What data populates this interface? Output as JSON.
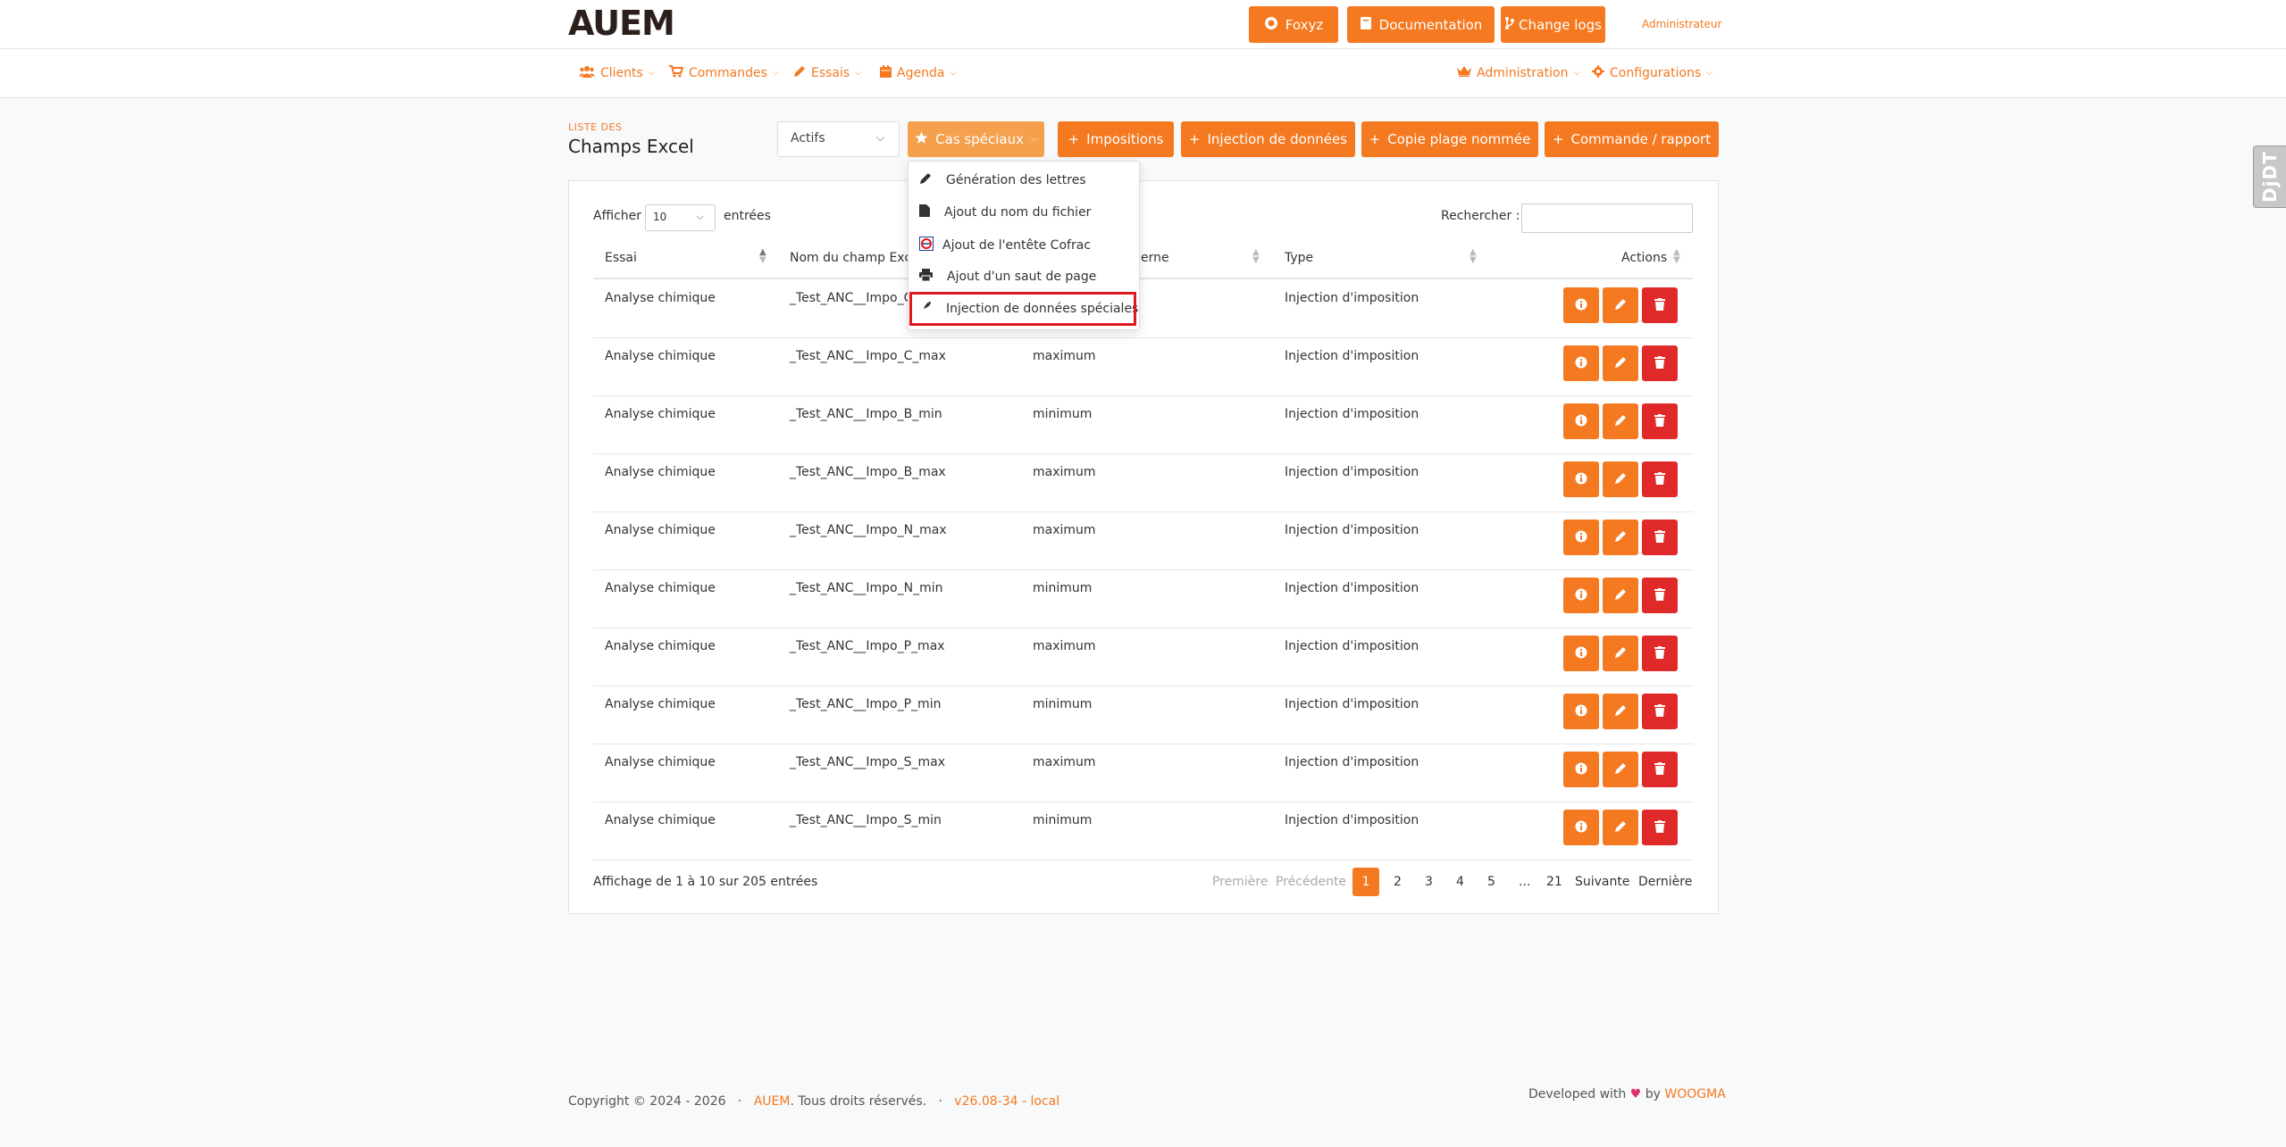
{
  "brand": {
    "logo_text": "AUEM"
  },
  "topbar": {
    "buttons": [
      {
        "label": "Foxyz",
        "icon": "foxyz-icon"
      },
      {
        "label": "Documentation",
        "icon": "book-icon"
      },
      {
        "label": "Change logs",
        "icon": "branch-icon"
      }
    ],
    "user_label": "Administrateur"
  },
  "nav": {
    "left": [
      {
        "label": "Clients",
        "icon": "users-icon"
      },
      {
        "label": "Commandes",
        "icon": "cart-icon"
      },
      {
        "label": "Essais",
        "icon": "pencil-icon"
      },
      {
        "label": "Agenda",
        "icon": "calendar-icon"
      }
    ],
    "right": [
      {
        "label": "Administration",
        "icon": "crown-icon"
      },
      {
        "label": "Configurations",
        "icon": "gear-icon"
      }
    ]
  },
  "page": {
    "subtitle": "LISTE DES",
    "title": "Champs Excel",
    "status_value": "Actifs"
  },
  "actions": {
    "special": "Cas spéciaux",
    "impositions": "Impositions",
    "injection": "Injection de données",
    "copy_range": "Copie plage nommée",
    "command_report": "Commande / rapport"
  },
  "dropdown": {
    "items": [
      {
        "label": "Génération des lettres",
        "icon": "pen-icon"
      },
      {
        "label": "Ajout du nom du fichier",
        "icon": "file-icon"
      },
      {
        "label": "Ajout de l'entête Cofrac",
        "icon": "cofrac-icon"
      },
      {
        "label": "Ajout d'un saut de page",
        "icon": "print-icon"
      },
      {
        "label": "Injection de données spéciales",
        "icon": "feather-icon"
      }
    ]
  },
  "table": {
    "length_label_before": "Afficher",
    "length_value": "10",
    "length_label_after": "entrées",
    "search_label": "Rechercher :",
    "columns": [
      "Essai",
      "Nom du champ Excel",
      "Nom interne",
      "Type",
      "Actions"
    ],
    "visible_headers": {
      "col1": "Essai",
      "col2": "Nom du champ Exce",
      "col3": "erne",
      "col4": "Type",
      "col5": "Actions"
    },
    "rows": [
      {
        "essai": "Analyse chimique",
        "champ": "_Test_ANC__Impo_C",
        "interne": "",
        "type": "Injection d'imposition"
      },
      {
        "essai": "Analyse chimique",
        "champ": "_Test_ANC__Impo_C_max",
        "interne": "maximum",
        "type": "Injection d'imposition"
      },
      {
        "essai": "Analyse chimique",
        "champ": "_Test_ANC__Impo_B_min",
        "interne": "minimum",
        "type": "Injection d'imposition"
      },
      {
        "essai": "Analyse chimique",
        "champ": "_Test_ANC__Impo_B_max",
        "interne": "maximum",
        "type": "Injection d'imposition"
      },
      {
        "essai": "Analyse chimique",
        "champ": "_Test_ANC__Impo_N_max",
        "interne": "maximum",
        "type": "Injection d'imposition"
      },
      {
        "essai": "Analyse chimique",
        "champ": "_Test_ANC__Impo_N_min",
        "interne": "minimum",
        "type": "Injection d'imposition"
      },
      {
        "essai": "Analyse chimique",
        "champ": "_Test_ANC__Impo_P_max",
        "interne": "maximum",
        "type": "Injection d'imposition"
      },
      {
        "essai": "Analyse chimique",
        "champ": "_Test_ANC__Impo_P_min",
        "interne": "minimum",
        "type": "Injection d'imposition"
      },
      {
        "essai": "Analyse chimique",
        "champ": "_Test_ANC__Impo_S_max",
        "interne": "maximum",
        "type": "Injection d'imposition"
      },
      {
        "essai": "Analyse chimique",
        "champ": "_Test_ANC__Impo_S_min",
        "interne": "minimum",
        "type": "Injection d'imposition"
      }
    ],
    "info": "Affichage de 1 à 10 sur 205 entrées"
  },
  "pagination": {
    "first": "Première",
    "prev": "Précédente",
    "pages": [
      "1",
      "2",
      "3",
      "4",
      "5",
      "...",
      "21"
    ],
    "next": "Suivante",
    "last": "Dernière",
    "current": "1"
  },
  "footer": {
    "copyright": "Copyright © 2024 - 2026",
    "sep": "·",
    "brand": "AUEM",
    "rights": ". Tous droits réservés.",
    "version": "v26.08-34 - local",
    "developed_with": "Developed with",
    "by": "by",
    "company": "WOOGMA"
  },
  "side_tab": {
    "label": "DjDT"
  },
  "colors": {
    "accent": "#f47920",
    "danger": "#e02a2a",
    "highlight": "#e0171f"
  }
}
